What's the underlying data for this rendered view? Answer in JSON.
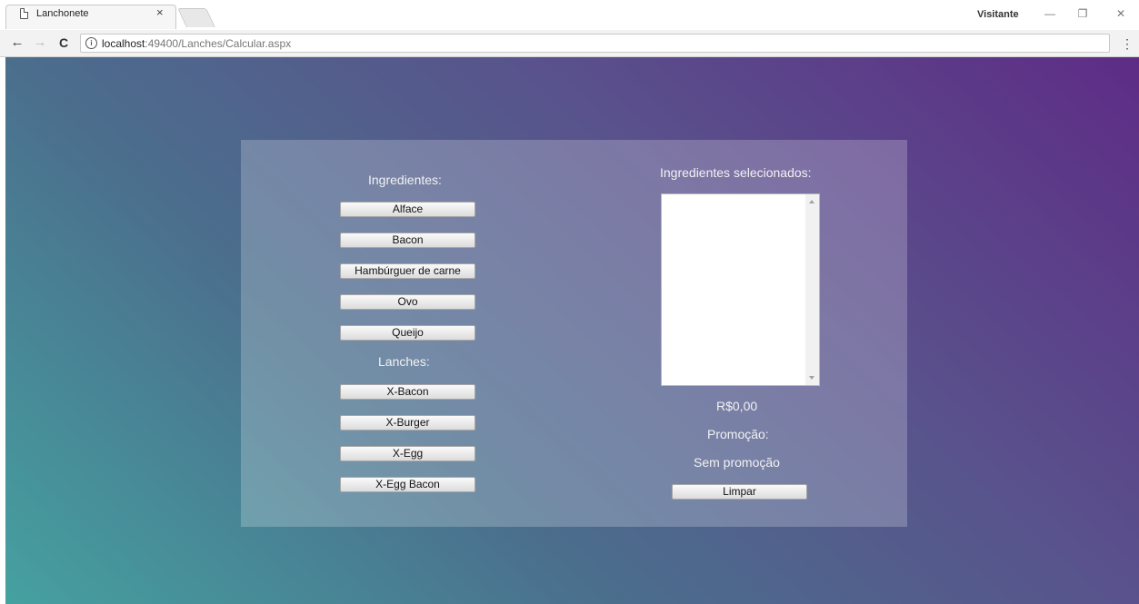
{
  "browser": {
    "tab_title": "Lanchonete",
    "tab_close": "×",
    "user_label": "Visitante",
    "window_minimize": "—",
    "window_restore": "❐",
    "window_close": "✕",
    "back": "←",
    "forward": "→",
    "reload": "C",
    "info": "i",
    "url_host": "localhost",
    "url_rest": ":49400/Lanches/Calcular.aspx",
    "menu": "⋮"
  },
  "page": {
    "ingredients_heading": "Ingredientes:",
    "ingredients": [
      "Alface",
      "Bacon",
      "Hambúrguer de carne",
      "Ovo",
      "Queijo"
    ],
    "snacks_heading": "Lanches:",
    "snacks": [
      "X-Bacon",
      "X-Burger",
      "X-Egg",
      "X-Egg Bacon"
    ],
    "selected_heading": "Ingredientes selecionados:",
    "selected_items": [],
    "total": "R$0,00",
    "promotion_heading": "Promoção:",
    "promotion_value": "Sem promoção",
    "clear_button": "Limpar"
  },
  "colors": {
    "gradient_top_right": "#5e2c86",
    "gradient_bottom_left": "#45a1a0"
  }
}
